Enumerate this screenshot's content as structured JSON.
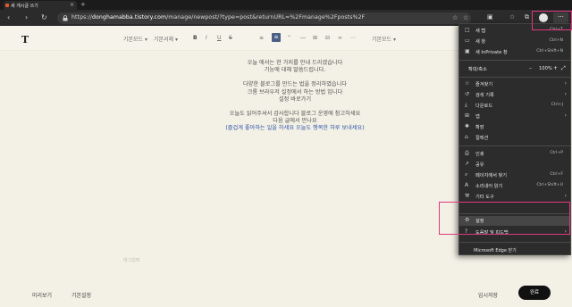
{
  "browser": {
    "tab_title": "새 게시글 쓰기",
    "tab_close": "×",
    "new_tab": "+",
    "back": "‹",
    "forward": "›",
    "refresh": "↻",
    "url": {
      "prefix": "https://",
      "host": "donghamabba.tistory.com",
      "path": "/manage/newpost/?type=post&returnURL=%2Fmanage%2Fposts%2F"
    },
    "more_label": "···"
  },
  "editor": {
    "logo": "T",
    "toolbar": [
      "기본모드 ▾",
      "기본서체 ▾",
      "B",
      "I",
      "U",
      "S",
      "≡",
      "≡",
      "“",
      "―",
      "⊞",
      "⊟",
      "∞",
      "⋯",
      "기본모드 ▾"
    ],
    "content_lines": [
      "오늘 에서는 한 가지를 안내 드리겠습니다",
      "기능에 대해 말씀드립니다.",
      "",
      "다양한 블로그를 만드는 법을 정리하였습니다",
      "크롬 브라우저 설정에서 하는 방법 입니다",
      "설정 바로가기",
      "",
      "오늘도 읽어주셔서 감사합니다 블로그 운영에 참고하세요",
      "다음 글에서 만나요",
      "(즐겁게 좋아하는 일을 하세요 오늘도 행복한 하루 보내세요)"
    ],
    "placeholder_hint": "태그입력",
    "bottom": {
      "left1": "미리보기",
      "left2": "기본설정",
      "right": "임시저장",
      "publish": "완료"
    }
  },
  "menu": {
    "items": [
      {
        "icon": "□",
        "label": "새 탭",
        "shortcut": "Ctrl+T"
      },
      {
        "icon": "▭",
        "label": "새 창",
        "shortcut": "Ctrl+N"
      },
      {
        "icon": "▣",
        "label": "새 InPrivate 창",
        "shortcut": "Ctrl+Shift+N"
      },
      {
        "label": "확대/축소",
        "zoom_out": "–",
        "zoom": "100%",
        "zoom_in": "+",
        "fullscreen": "⤢"
      },
      {
        "icon": "☆",
        "label": "즐겨찾기",
        "arrow": "›"
      },
      {
        "icon": "↺",
        "label": "검색 기록",
        "arrow": "›"
      },
      {
        "icon": "⤓",
        "label": "다운로드",
        "shortcut": "Ctrl+J"
      },
      {
        "icon": "⊞",
        "label": "앱",
        "arrow": "›"
      },
      {
        "icon": "✱",
        "label": "확장"
      },
      {
        "icon": "⌂",
        "label": "컬렉션"
      },
      {
        "icon": "⎙",
        "label": "인쇄",
        "shortcut": "Ctrl+P"
      },
      {
        "icon": "↗",
        "label": "공유"
      },
      {
        "icon": "⌕",
        "label": "페이지에서 찾기",
        "shortcut": "Ctrl+F"
      },
      {
        "icon": "A",
        "label": "소리내어 읽기",
        "shortcut": "Ctrl+Shift+U"
      },
      {
        "icon": "⚒",
        "label": "기타 도구",
        "arrow": "›"
      },
      {
        "icon": "⚙",
        "label": "설정"
      },
      {
        "icon": "?",
        "label": "도움말 및 피드백",
        "arrow": "›"
      }
    ],
    "footer": "Microsoft Edge 닫기"
  },
  "colors": {
    "highlight": "#e0377f",
    "page_bg": "#f3f1e6",
    "menu_bg": "#2c2c2c",
    "content_blue": "#2e53a7"
  }
}
